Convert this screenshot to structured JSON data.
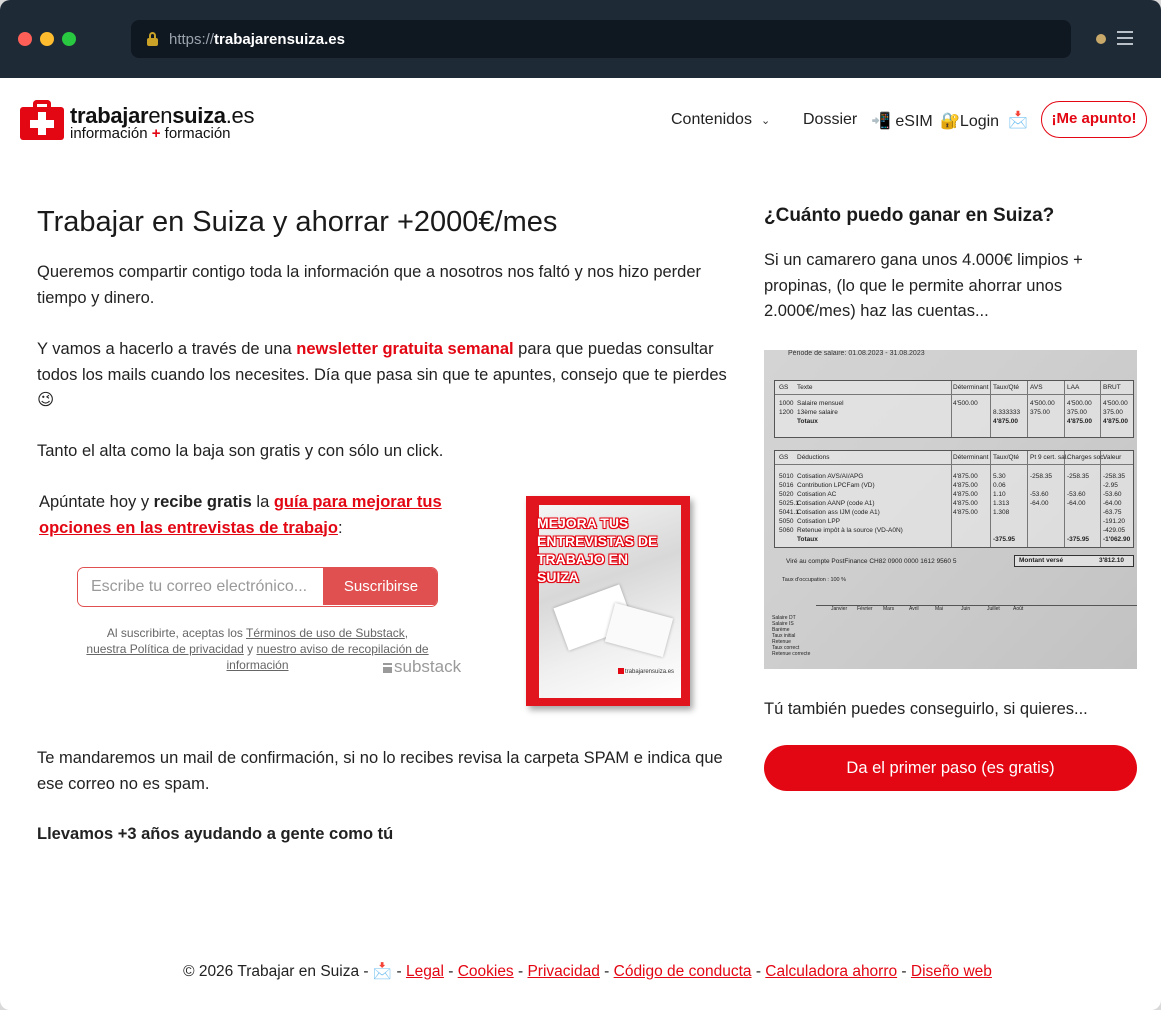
{
  "browser": {
    "url_scheme": "https://",
    "url_host": "trabajarensuiza.es"
  },
  "header": {
    "logo_part1": "trabajar",
    "logo_part2": "en",
    "logo_part3": "suiza",
    "logo_part4": ".es",
    "logo_sub_a": "información",
    "logo_sub_plus": "+",
    "logo_sub_b": "formación",
    "nav": {
      "contenidos": "Contenidos",
      "dossier": "Dossier",
      "esim": "📲 eSIM",
      "login": "🔐Login",
      "mail": "📩",
      "cta": "¡Me apunto!"
    }
  },
  "main": {
    "title": "Trabajar en Suiza y ahorrar +2000€/mes",
    "p1": "Queremos compartir contigo toda la información que a nosotros nos faltó y nos hizo perder tiempo y dinero.",
    "p2_a": "Y vamos a hacerlo a través de una ",
    "p2_link": "newsletter gratuita semanal",
    "p2_b": " para que puedas consultar todos los mails cuando los necesites. Día que pasa sin que te apuntes, consejo que te pierdes 😉",
    "p3": "Tanto el alta como la baja son gratis y con sólo un click.",
    "signup_a": "Apúntate hoy y ",
    "signup_bold": "recibe gratis",
    "signup_b": " la ",
    "signup_link": "guía para mejorar tus opciones en las entrevistas de trabajo",
    "signup_c": ":",
    "email_placeholder": "Escribe tu correo electrónico...",
    "subscribe": "Suscribirse",
    "legal_a": "Al suscribirte, aceptas los ",
    "legal_terms": "Términos de uso de Substack",
    "legal_b": ", ",
    "legal_privacy": "nuestra Política de privacidad",
    "legal_c": " y ",
    "legal_notice": "nuestro aviso de recopilación de información",
    "substack": "substack",
    "booklet_title": "MEJORA TUS ENTREVISTAS DE TRABAJO EN SUIZA",
    "booklet_logo": "trabajarensuiza.es",
    "p4": "Te mandaremos un mail de confirmación, si no lo recibes revisa la carpeta SPAM e indica que ese correo no es spam.",
    "p5": "Llevamos +3 años ayudando a gente como tú"
  },
  "side": {
    "title": "¿Cuánto puedo ganar en Suiza?",
    "p1": "Si un camarero gana unos 4.000€ limpios + propinas, (lo que le permite ahorrar unos 2.000€/mes) haz las cuentas...",
    "payslip": {
      "period": "Période de salaire: 01.08.2023 - 31.08.2023",
      "h1": [
        "GS",
        "Texte",
        "Déterminant",
        "Taux/Qté",
        "AVS",
        "LAA",
        "BRUT"
      ],
      "r1": [
        "1000",
        "Salaire mensuel",
        "4'500.00",
        "",
        "4'500.00",
        "4'500.00",
        "4'500.00"
      ],
      "r2": [
        "1200",
        "13ème salaire",
        "",
        "8.333333",
        "375.00",
        "375.00",
        "375.00"
      ],
      "tot1": [
        "Totaux",
        "4'875.00",
        "4'875.00",
        "4'875.00"
      ],
      "h2": [
        "GS",
        "Déductions",
        "Déterminant",
        "Taux/Qté",
        "Pt 9 cert. sal.",
        "Charges soc.",
        "Valeur"
      ],
      "d1": [
        "5010",
        "Cotisation AVS/AI/APG",
        "4'875.00",
        "5.30",
        "-258.35",
        "-258.35",
        "-258.35"
      ],
      "d2": [
        "5016",
        "Contribution LPCFam (VD)",
        "4'875.00",
        "0.06",
        "",
        "",
        "-2.95"
      ],
      "d3": [
        "5020",
        "Cotisation AC",
        "4'875.00",
        "1.10",
        "-53.60",
        "-53.60",
        "-53.60"
      ],
      "d4": [
        "5025.1",
        "Cotisation AANP (code A1)",
        "4'875.00",
        "1.313",
        "-64.00",
        "-64.00",
        "-64.00"
      ],
      "d5": [
        "5041.1",
        "Cotisation ass IJM (code A1)",
        "4'875.00",
        "1.308",
        "",
        "",
        "-63.75"
      ],
      "d6": [
        "5050",
        "Cotisation LPP",
        "",
        "",
        "",
        "",
        "-191.20"
      ],
      "d7": [
        "5060",
        "Retenue impôt à la source (VD-A0N)",
        "",
        "",
        "",
        "",
        "-429.05"
      ],
      "tot2": [
        "Totaux",
        "-375.95",
        "-375.95",
        "-1'062.90"
      ],
      "transfer": "Viré au compte PostFinance CH82 0900 0000 1612 9560 5",
      "paid_label": "Montant versé",
      "paid_value": "3'812.10",
      "rate": "Taux d'occupation : 100 %",
      "months": [
        "Janvier",
        "Février",
        "Mars",
        "Avril",
        "Mai",
        "Juin",
        "Juillet",
        "Août"
      ],
      "rows": [
        "Salaire DT",
        "Salaire IS",
        "Barème",
        "Taux initial",
        "Retenue",
        "Taux correct",
        "Retenue correcte"
      ]
    },
    "p2": "Tú también puedes conseguirlo, si quieres...",
    "cta": "Da el primer paso (es gratis)"
  },
  "footer": {
    "copyright": "© 2026 Trabajar en Suiza - ",
    "mail": "📩",
    "legal": "Legal",
    "cookies": "Cookies",
    "privacy": "Privacidad",
    "conduct": "Código de conducta",
    "calculator": "Calculadora ahorro",
    "design": "Diseño web",
    "sep": " - "
  }
}
